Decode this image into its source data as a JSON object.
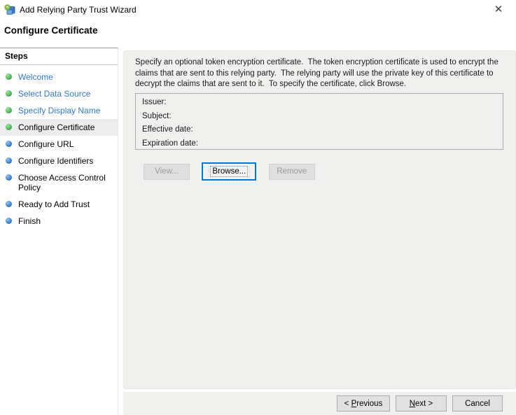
{
  "window": {
    "title": "Add Relying Party Trust Wizard",
    "close_glyph": "✕"
  },
  "page": {
    "heading": "Configure Certificate"
  },
  "sidebar": {
    "header": "Steps",
    "items": [
      {
        "label": "Welcome",
        "dot": "green",
        "link": true,
        "current": false
      },
      {
        "label": "Select Data Source",
        "dot": "green",
        "link": true,
        "current": false
      },
      {
        "label": "Specify Display Name",
        "dot": "green",
        "link": true,
        "current": false
      },
      {
        "label": "Configure Certificate",
        "dot": "green",
        "link": false,
        "current": true
      },
      {
        "label": "Configure URL",
        "dot": "blue",
        "link": false,
        "current": false
      },
      {
        "label": "Configure Identifiers",
        "dot": "blue",
        "link": false,
        "current": false
      },
      {
        "label": "Choose Access Control Policy",
        "dot": "blue",
        "link": false,
        "current": false
      },
      {
        "label": "Ready to Add Trust",
        "dot": "blue",
        "link": false,
        "current": false
      },
      {
        "label": "Finish",
        "dot": "blue",
        "link": false,
        "current": false
      }
    ]
  },
  "content": {
    "description": "Specify an optional token encryption certificate.  The token encryption certificate is used to encrypt the claims that are sent to this relying party.  The relying party will use the private key of this certificate to decrypt the claims that are sent to it.  To specify the certificate, click Browse.",
    "certificate_fields": [
      {
        "label": "Issuer:",
        "value": ""
      },
      {
        "label": "Subject:",
        "value": ""
      },
      {
        "label": "Effective date:",
        "value": ""
      },
      {
        "label": "Expiration date:",
        "value": ""
      }
    ],
    "buttons": {
      "view": "View...",
      "browse": "Browse...",
      "remove": "Remove"
    }
  },
  "footer": {
    "previous": "< Previous",
    "previous_mnemonic": "P",
    "next": "Next >",
    "next_mnemonic": "N",
    "cancel": "Cancel"
  },
  "colors": {
    "link_blue": "#3079d8",
    "step_done_green": "#3cb44a",
    "step_pending_blue": "#2c7cd4",
    "focus_blue": "#0078d7",
    "panel_bg": "#f0f0ee",
    "highlight_bg": "#ececec"
  }
}
